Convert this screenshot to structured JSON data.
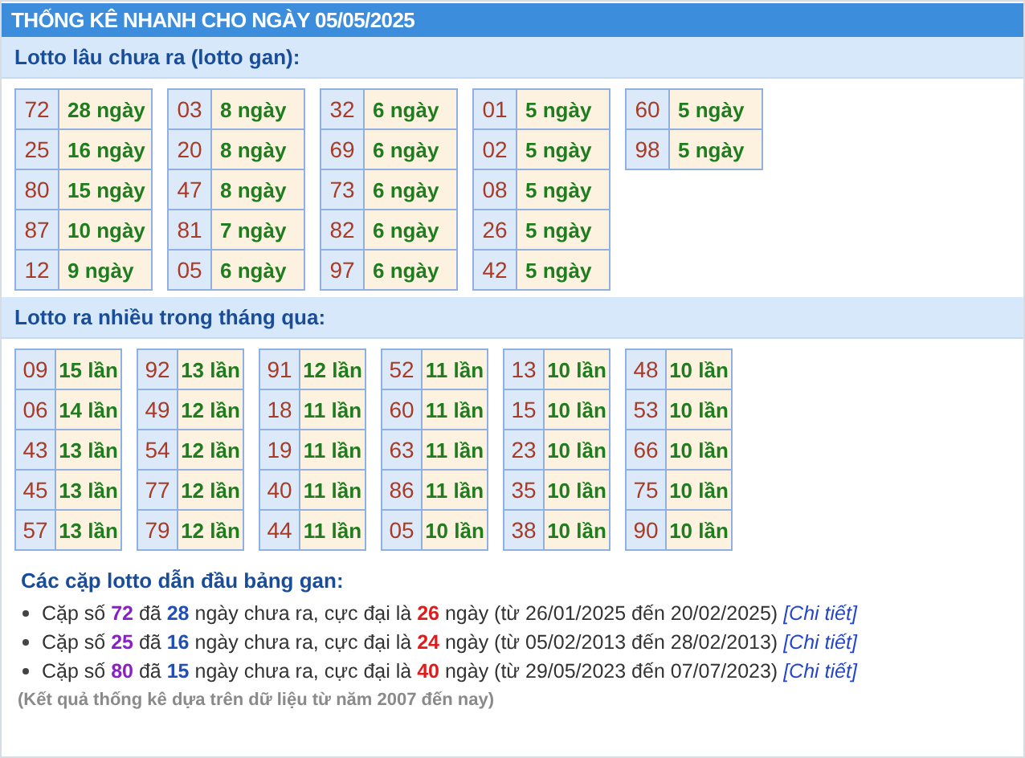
{
  "title": "THỐNG KÊ NHANH CHO NGÀY 05/05/2025",
  "gan": {
    "heading": "Lotto lâu chưa ra (lotto gan):",
    "tables": [
      [
        [
          "72",
          "28 ngày"
        ],
        [
          "25",
          "16 ngày"
        ],
        [
          "80",
          "15 ngày"
        ],
        [
          "87",
          "10 ngày"
        ],
        [
          "12",
          "9 ngày"
        ]
      ],
      [
        [
          "03",
          "8 ngày"
        ],
        [
          "20",
          "8 ngày"
        ],
        [
          "47",
          "8 ngày"
        ],
        [
          "81",
          "7 ngày"
        ],
        [
          "05",
          "6 ngày"
        ]
      ],
      [
        [
          "32",
          "6 ngày"
        ],
        [
          "69",
          "6 ngày"
        ],
        [
          "73",
          "6 ngày"
        ],
        [
          "82",
          "6 ngày"
        ],
        [
          "97",
          "6 ngày"
        ]
      ],
      [
        [
          "01",
          "5 ngày"
        ],
        [
          "02",
          "5 ngày"
        ],
        [
          "08",
          "5 ngày"
        ],
        [
          "26",
          "5 ngày"
        ],
        [
          "42",
          "5 ngày"
        ]
      ],
      [
        [
          "60",
          "5 ngày"
        ],
        [
          "98",
          "5 ngày"
        ]
      ]
    ]
  },
  "frequent": {
    "heading": "Lotto ra nhiều trong tháng qua:",
    "tables": [
      [
        [
          "09",
          "15 lần"
        ],
        [
          "06",
          "14 lần"
        ],
        [
          "43",
          "13 lần"
        ],
        [
          "45",
          "13 lần"
        ],
        [
          "57",
          "13 lần"
        ]
      ],
      [
        [
          "92",
          "13 lần"
        ],
        [
          "49",
          "12 lần"
        ],
        [
          "54",
          "12 lần"
        ],
        [
          "77",
          "12 lần"
        ],
        [
          "79",
          "12 lần"
        ]
      ],
      [
        [
          "91",
          "12 lần"
        ],
        [
          "18",
          "11 lần"
        ],
        [
          "19",
          "11 lần"
        ],
        [
          "40",
          "11 lần"
        ],
        [
          "44",
          "11 lần"
        ]
      ],
      [
        [
          "52",
          "11 lần"
        ],
        [
          "60",
          "11 lần"
        ],
        [
          "63",
          "11 lần"
        ],
        [
          "86",
          "11 lần"
        ],
        [
          "05",
          "10 lần"
        ]
      ],
      [
        [
          "13",
          "10 lần"
        ],
        [
          "15",
          "10 lần"
        ],
        [
          "23",
          "10 lần"
        ],
        [
          "35",
          "10 lần"
        ],
        [
          "38",
          "10 lần"
        ]
      ],
      [
        [
          "48",
          "10 lần"
        ],
        [
          "53",
          "10 lần"
        ],
        [
          "66",
          "10 lần"
        ],
        [
          "75",
          "10 lần"
        ],
        [
          "90",
          "10 lần"
        ]
      ]
    ]
  },
  "leaders": {
    "heading": "Các cặp lotto dẫn đầu bảng gan:",
    "items": [
      [
        {
          "kind": "plain",
          "text": "Cặp số "
        },
        {
          "kind": "pair",
          "text": "72"
        },
        {
          "kind": "plain",
          "text": " đã "
        },
        {
          "kind": "days",
          "text": "28"
        },
        {
          "kind": "plain",
          "text": " ngày chưa ra, cực đại là "
        },
        {
          "kind": "max",
          "text": "26"
        },
        {
          "kind": "plain",
          "text": " ngày (từ 26/01/2025 đến 20/02/2025) "
        },
        {
          "kind": "link",
          "text": "[Chi tiết]"
        }
      ],
      [
        {
          "kind": "plain",
          "text": "Cặp số "
        },
        {
          "kind": "pair",
          "text": "25"
        },
        {
          "kind": "plain",
          "text": " đã "
        },
        {
          "kind": "days",
          "text": "16"
        },
        {
          "kind": "plain",
          "text": " ngày chưa ra, cực đại là "
        },
        {
          "kind": "max",
          "text": "24"
        },
        {
          "kind": "plain",
          "text": " ngày (từ 05/02/2013 đến 28/02/2013) "
        },
        {
          "kind": "link",
          "text": "[Chi tiết]"
        }
      ],
      [
        {
          "kind": "plain",
          "text": "Cặp số "
        },
        {
          "kind": "pair",
          "text": "80"
        },
        {
          "kind": "plain",
          "text": " đã "
        },
        {
          "kind": "days",
          "text": "15"
        },
        {
          "kind": "plain",
          "text": " ngày chưa ra, cực đại là "
        },
        {
          "kind": "max",
          "text": "40"
        },
        {
          "kind": "plain",
          "text": " ngày (từ 29/05/2023 đến 07/07/2023) "
        },
        {
          "kind": "link",
          "text": "[Chi tiết]"
        }
      ]
    ],
    "note": "(Kết quả thống kê dựa trên dữ liệu từ năm 2007 đến nay)"
  }
}
